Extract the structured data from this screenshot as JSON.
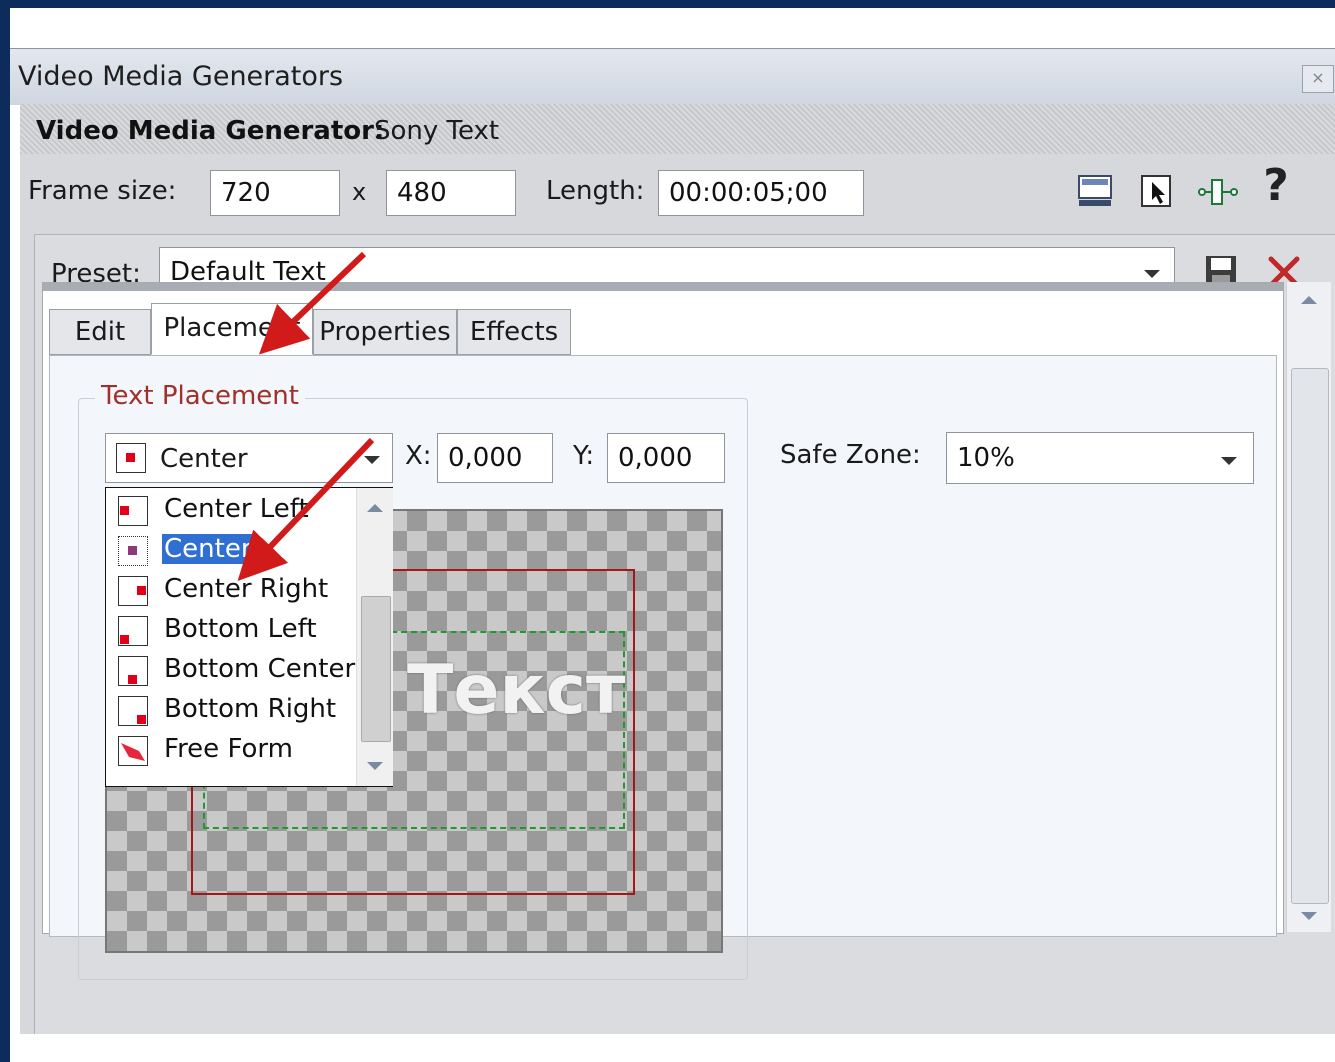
{
  "window": {
    "title": "Video Media Generators",
    "close_glyph": "×"
  },
  "generator": {
    "label": "Video Media Generator:",
    "value": "Sony Text"
  },
  "frame": {
    "frame_size_label": "Frame size:",
    "width": "720",
    "by": "x",
    "height": "480",
    "length_label": "Length:",
    "length": "00:00:05;00"
  },
  "toolbar_icons": [
    "monitor-icon",
    "select-cursor-icon",
    "keyframe-icon",
    "help-icon"
  ],
  "help_glyph": "?",
  "preset": {
    "label": "Preset:",
    "value": "Default Text",
    "save_icon": "save-icon",
    "delete_icon": "delete-icon"
  },
  "tabs": [
    {
      "label": "Edit",
      "active": false
    },
    {
      "label": "Placement",
      "active": true
    },
    {
      "label": "Properties",
      "active": false
    },
    {
      "label": "Effects",
      "active": false
    }
  ],
  "placement": {
    "group_title": "Text Placement",
    "selected": "Center",
    "x_label": "X:",
    "x_value": "0,000",
    "y_label": "Y:",
    "y_value": "0,000",
    "safe_zone_label": "Safe Zone:",
    "safe_zone_value": "10%",
    "options": [
      {
        "label": "Center Left",
        "pos": "cl"
      },
      {
        "label": "Center",
        "pos": "c",
        "selected": true
      },
      {
        "label": "Center Right",
        "pos": "cr"
      },
      {
        "label": "Bottom Left",
        "pos": "bl"
      },
      {
        "label": "Bottom Center",
        "pos": "bc"
      },
      {
        "label": "Bottom Right",
        "pos": "br"
      },
      {
        "label": "Free Form",
        "pos": "ff"
      }
    ],
    "preview_text": "Текст"
  },
  "colors": {
    "accent": "#2f6fd1",
    "group_title": "#a0302a",
    "annotation_arrow": "#d11a1a"
  }
}
